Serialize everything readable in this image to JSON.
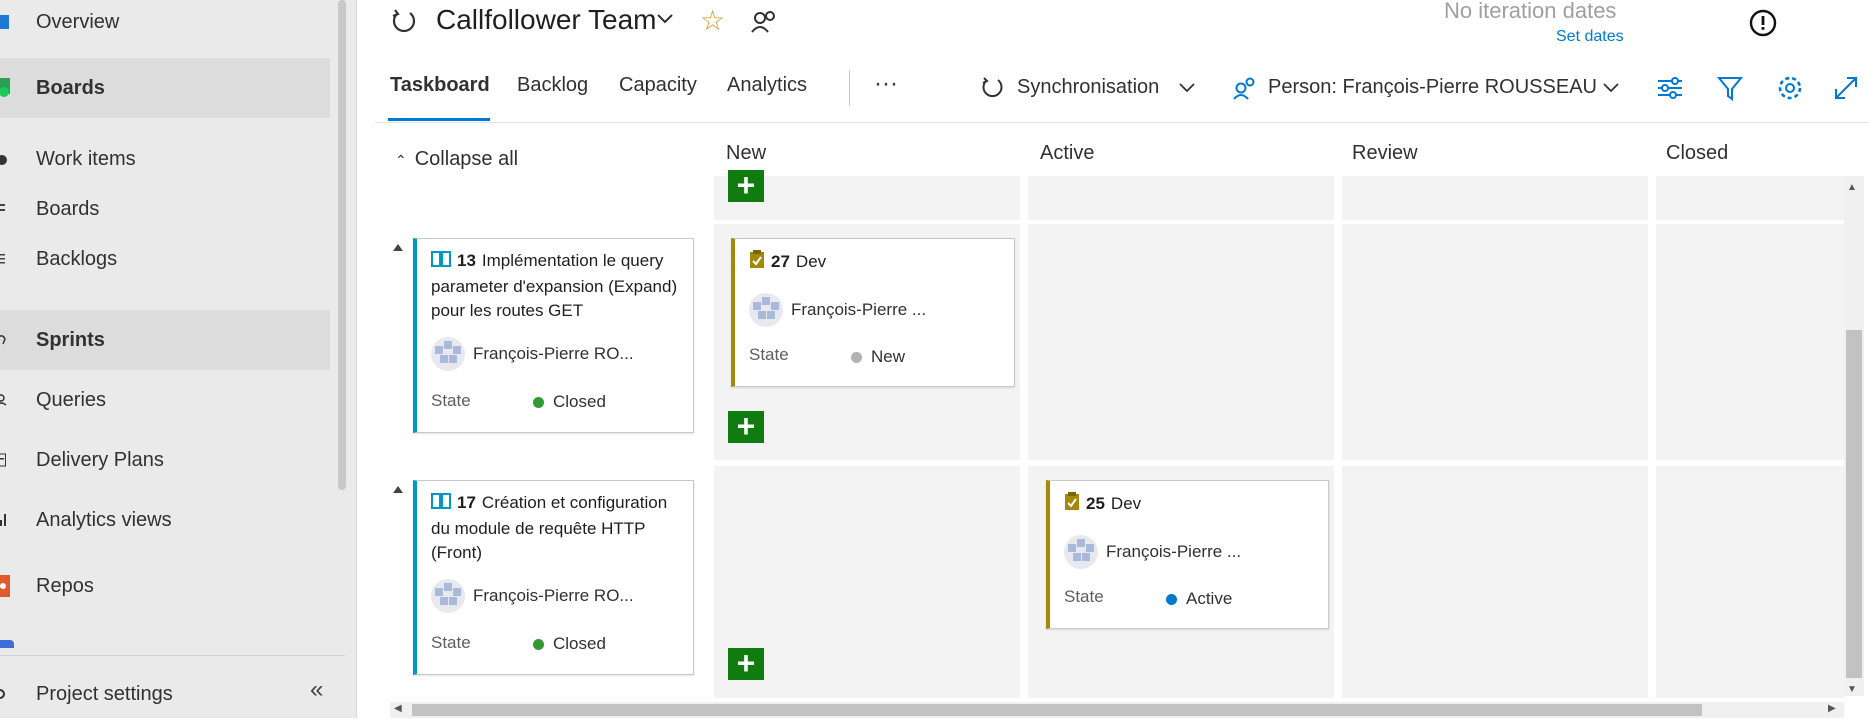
{
  "sidebar": {
    "items": [
      {
        "label": "Overview",
        "icon": "overview-icon"
      },
      {
        "label": "Boards",
        "icon": "boards-hub-icon"
      },
      {
        "label": "Work items",
        "icon": "work-items-icon"
      },
      {
        "label": "Boards",
        "icon": "boards-icon"
      },
      {
        "label": "Backlogs",
        "icon": "backlogs-icon"
      },
      {
        "label": "Sprints",
        "icon": "sprints-icon"
      },
      {
        "label": "Queries",
        "icon": "queries-icon"
      },
      {
        "label": "Delivery Plans",
        "icon": "delivery-plans-icon"
      },
      {
        "label": "Analytics views",
        "icon": "analytics-views-icon"
      },
      {
        "label": "Repos",
        "icon": "repos-icon"
      }
    ],
    "project_settings": "Project settings",
    "collapse_glyph": "«"
  },
  "header": {
    "team": "Callfollower Team",
    "no_iteration": "No iteration dates",
    "set_dates": "Set dates"
  },
  "tabs": [
    "Taskboard",
    "Backlog",
    "Capacity",
    "Analytics"
  ],
  "toolbar": {
    "more": "···",
    "sprint": "Synchronisation",
    "person_filter": "Person: François-Pierre ROUSSEAU"
  },
  "board": {
    "collapse_all": "Collapse all",
    "columns": [
      "New",
      "Active",
      "Review",
      "Closed"
    ],
    "rows": [
      {
        "story": {
          "id": "13",
          "title": "Implémentation le query parameter d'expansion (Expand)  pour les routes GET",
          "assignee": "François-Pierre RO...",
          "state_label": "State",
          "state": "Closed"
        },
        "task": {
          "id": "27",
          "title": "Dev",
          "assignee": "François-Pierre ...",
          "state_label": "State",
          "state": "New"
        }
      },
      {
        "story": {
          "id": "17",
          "title": "Création et configuration du module de requête HTTP (Front)",
          "assignee": "François-Pierre RO...",
          "state_label": "State",
          "state": "Closed"
        },
        "task": {
          "id": "25",
          "title": "Dev",
          "assignee": "François-Pierre ...",
          "state_label": "State",
          "state": "Active"
        }
      }
    ],
    "add_glyph": "+"
  },
  "colors": {
    "accent": "#0078d4",
    "add_button": "#107c10",
    "story_bar": "#0098c7",
    "task_bar": "#a4880a",
    "state_closed": "#339933",
    "state_new": "#b2b2b2",
    "state_active": "#007acc",
    "star": "#e8912d"
  }
}
